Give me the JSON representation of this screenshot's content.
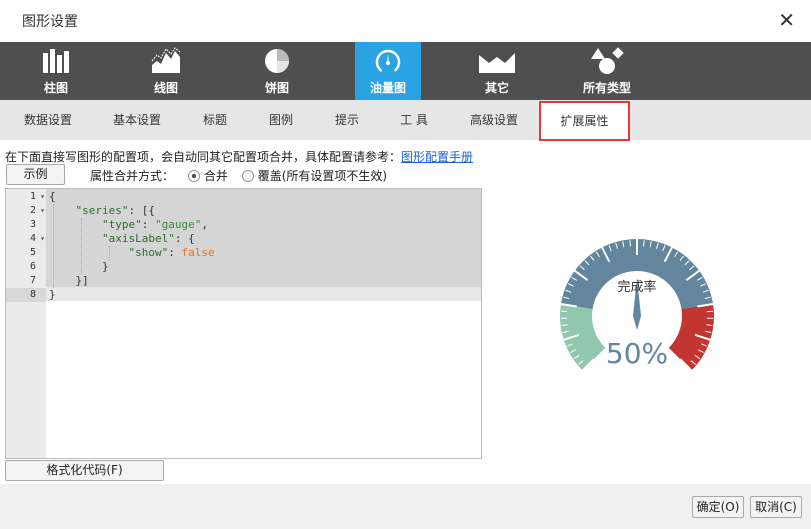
{
  "dialog": {
    "title": "图形设置"
  },
  "chart_types": [
    {
      "label": "柱图",
      "icon": "bar-chart-icon"
    },
    {
      "label": "线图",
      "icon": "line-chart-icon"
    },
    {
      "label": "饼图",
      "icon": "pie-chart-icon"
    },
    {
      "label": "油量图",
      "icon": "gauge-chart-icon",
      "active": true
    },
    {
      "label": "其它",
      "icon": "other-chart-icon"
    },
    {
      "label": "所有类型",
      "icon": "shapes-icon"
    }
  ],
  "tabs": [
    "数据设置",
    "基本设置",
    "标题",
    "图例",
    "提示",
    "工 具",
    "高级设置",
    "扩展属性"
  ],
  "active_tab": "扩展属性",
  "description": {
    "text": "在下面直接写图形的配置项，会自动同其它配置项合并，具体配置请参考：",
    "link": "图形配置手册"
  },
  "example_button": "示例",
  "merge": {
    "label": "属性合并方式：",
    "option_merge": "合并",
    "option_override": "覆盖(所有设置项不生效)",
    "selected": "合并"
  },
  "code": {
    "line_numbers": [
      "1",
      "2",
      "3",
      "4",
      "5",
      "6",
      "7",
      "8"
    ],
    "l1": "{",
    "l2_key": "\"series\"",
    "l2_rest": ": [{",
    "l3_key": "\"type\"",
    "l3_colon": ": ",
    "l3_val": "\"gauge\"",
    "l3_comma": ",",
    "l4_key": "\"axisLabel\"",
    "l4_rest": ": {",
    "l5_key": "\"show\"",
    "l5_colon": ": ",
    "l5_val": "false",
    "l6": "}",
    "l7": "}]",
    "l8": "}"
  },
  "format_button": "格式化代码(F)",
  "gauge": {
    "label": "完成率",
    "value_text": "50%",
    "value": 50,
    "colors": {
      "low": "#91c7ae",
      "mid": "#63869e",
      "high": "#c23531"
    }
  },
  "footer": {
    "ok": "确定(O)",
    "cancel": "取消(C)"
  }
}
